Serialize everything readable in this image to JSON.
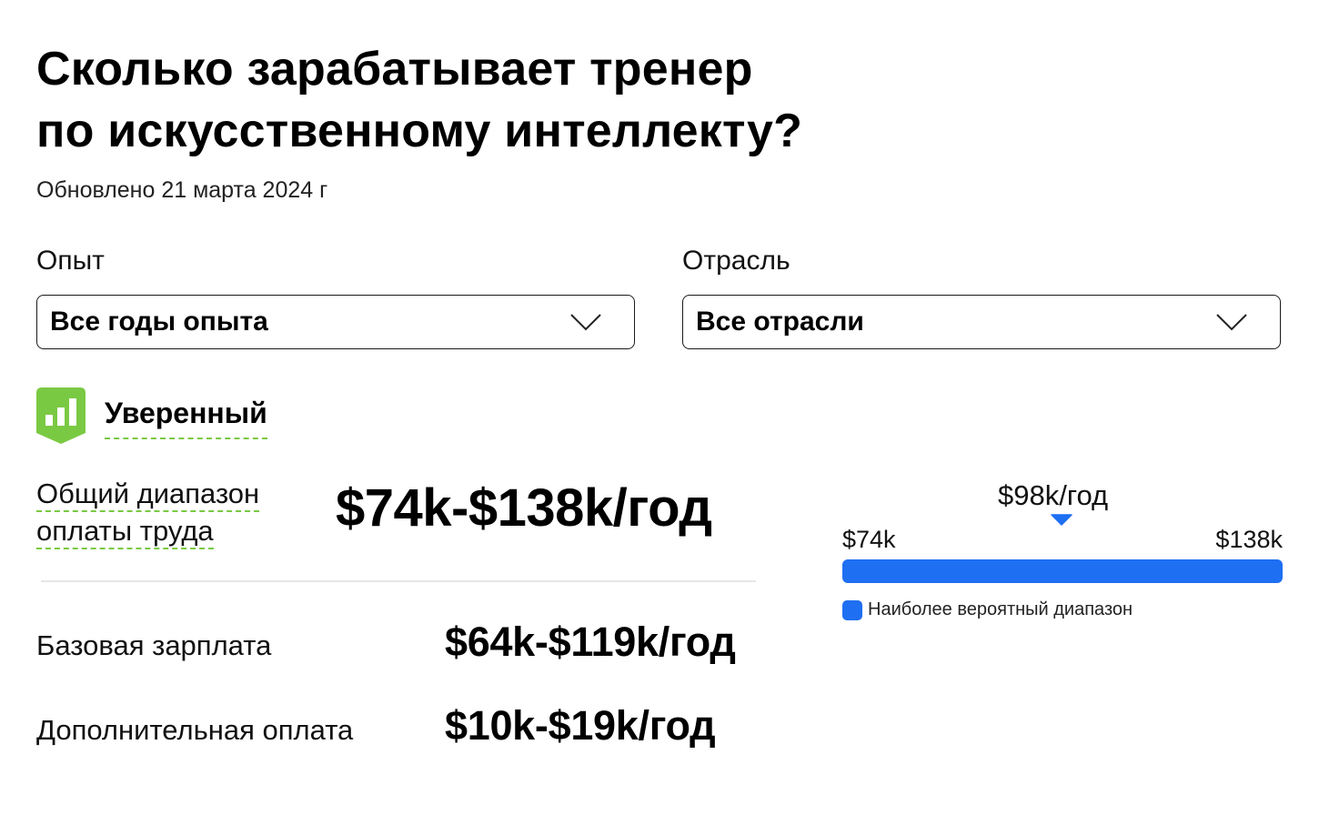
{
  "header": {
    "title_line1": "Сколько зарабатывает тренер",
    "title_line2": "по искусственному интеллекту?",
    "updated": "Обновлено 21 марта 2024 г"
  },
  "filters": {
    "experience": {
      "label": "Опыт",
      "selected": "Все годы опыта"
    },
    "industry": {
      "label": "Отрасль",
      "selected": "Все отрасли"
    }
  },
  "confidence": {
    "label": "Уверенный",
    "icon": "bar-chart-icon",
    "color": "#7ac943"
  },
  "pay": {
    "total_label_line1": "Общий диапазон",
    "total_label_line2": "оплаты труда",
    "total_value": "$74k-$138k/год",
    "base_label": "Базовая зарплата",
    "base_value": "$64k-$119k/год",
    "additional_label": "Дополнительная оплата",
    "additional_value": "$10k-$19k/год"
  },
  "range_chart": {
    "median_label": "$98k/год",
    "min_label": "$74k",
    "max_label": "$138k",
    "min": 74,
    "max": 138,
    "median": 98,
    "legend": "Наиболее вероятный диапазон",
    "bar_color": "#1f6ff2"
  }
}
